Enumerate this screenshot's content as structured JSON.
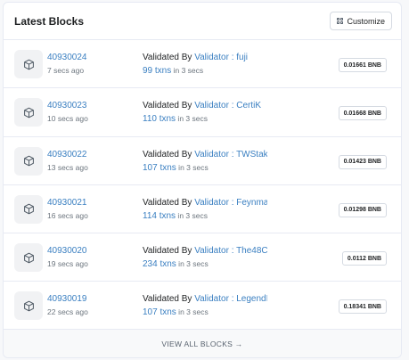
{
  "header": {
    "title": "Latest Blocks",
    "customize_label": "Customize"
  },
  "blocks": [
    {
      "number": "40930024",
      "age": "7 secs ago",
      "validated_prefix": "Validated By ",
      "validator": "Validator : fuji",
      "txns": "99 txns",
      "duration": " in 3 secs",
      "reward": "0.01661 BNB"
    },
    {
      "number": "40930023",
      "age": "10 secs ago",
      "validated_prefix": "Validated By ",
      "validator": "Validator : CertiK",
      "txns": "110 txns",
      "duration": " in 3 secs",
      "reward": "0.01668 BNB"
    },
    {
      "number": "40930022",
      "age": "13 secs ago",
      "validated_prefix": "Validated By ",
      "validator": "Validator : TWStak...",
      "txns": "107 txns",
      "duration": " in 3 secs",
      "reward": "0.01423 BNB"
    },
    {
      "number": "40930021",
      "age": "16 secs ago",
      "validated_prefix": "Validated By ",
      "validator": "Validator : Feynman",
      "txns": "114 txns",
      "duration": " in 3 secs",
      "reward": "0.01298 BNB"
    },
    {
      "number": "40930020",
      "age": "19 secs ago",
      "validated_prefix": "Validated By ",
      "validator": "Validator : The48C...",
      "txns": "234 txns",
      "duration": " in 3 secs",
      "reward": "0.0112 BNB"
    },
    {
      "number": "40930019",
      "age": "22 secs ago",
      "validated_prefix": "Validated By ",
      "validator": "Validator : LegendIII",
      "txns": "107 txns",
      "duration": " in 3 secs",
      "reward": "0.18341 BNB"
    }
  ],
  "footer": {
    "view_all_label": "VIEW ALL BLOCKS →"
  },
  "colors": {
    "link": "#3a7fc1",
    "text": "#1e2022",
    "muted": "#6c757e",
    "border": "#e7eaf3"
  },
  "icons": {
    "block": "cube-icon",
    "customize": "grid-icon"
  }
}
